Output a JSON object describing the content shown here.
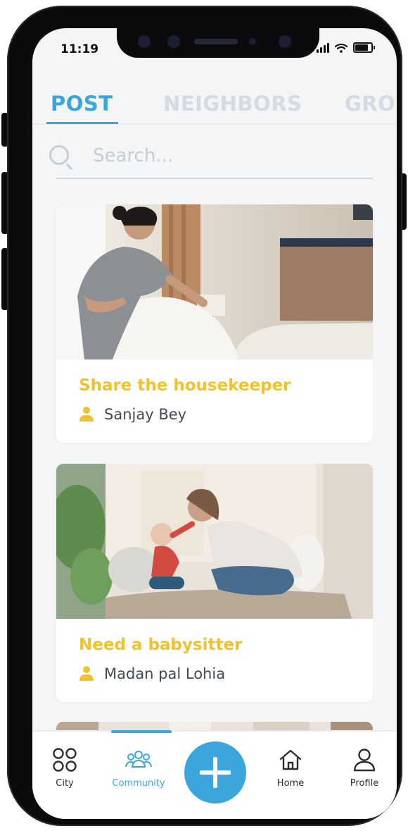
{
  "status_bar": {
    "time": "11:19"
  },
  "tabs": [
    {
      "label": "POST",
      "active": true
    },
    {
      "label": "NEIGHBORS",
      "active": false
    },
    {
      "label": "GROU",
      "active": false
    }
  ],
  "search": {
    "placeholder": "Search..."
  },
  "posts": [
    {
      "title": "Share the housekeeper",
      "author": "Sanjay Bey",
      "image": "housekeeper-photo"
    },
    {
      "title": "Need a babysitter",
      "author": "Madan pal Lohia",
      "image": "babysitter-photo"
    }
  ],
  "bottom_nav": {
    "items": [
      {
        "label": "City",
        "icon": "grid-circles-icon"
      },
      {
        "label": "Community",
        "icon": "community-icon",
        "active": true
      },
      {
        "label": "Home",
        "icon": "home-icon"
      },
      {
        "label": "Profile",
        "icon": "profile-icon"
      }
    ],
    "fab_icon": "plus-icon"
  },
  "colors": {
    "accent": "#3aa6dc",
    "title_yellow": "#f0c22b",
    "inactive_tab": "#d4dbe2",
    "background": "#f3f5f7"
  }
}
